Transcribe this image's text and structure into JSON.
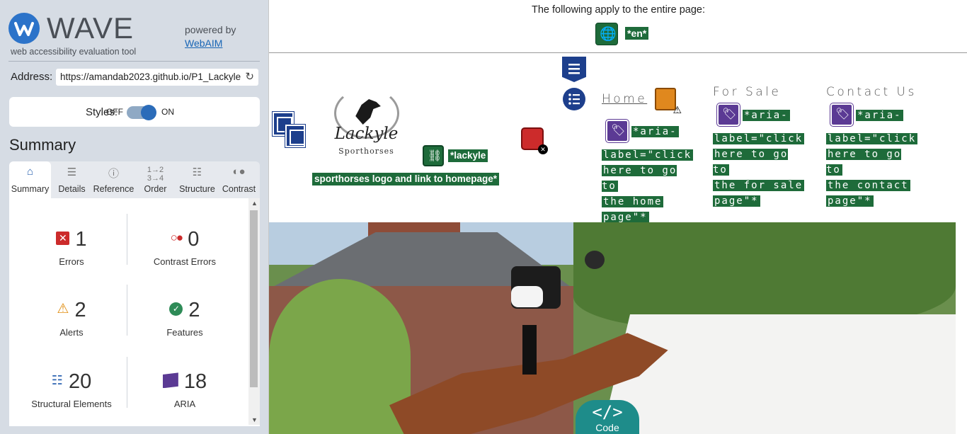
{
  "wave": {
    "logo_text": "WAVE",
    "logo_sub": "web accessibility evaluation tool",
    "powered_by": "powered by",
    "webaim_link": "WebAIM",
    "address_label": "Address:",
    "address_value": "https://amandab2023.github.io/P1_Lackyle",
    "styles_label": "Styles:",
    "styles_off": "OFF",
    "styles_on": "ON",
    "summary_title": "Summary",
    "tabs": [
      {
        "label": "Summary",
        "icon": "home-icon"
      },
      {
        "label": "Details",
        "icon": "list-icon"
      },
      {
        "label": "Reference",
        "icon": "info-icon"
      },
      {
        "label": "Order",
        "icon": "order-icon"
      },
      {
        "label": "Structure",
        "icon": "structure-icon"
      },
      {
        "label": "Contrast",
        "icon": "contrast-icon"
      }
    ],
    "stats": {
      "errors": {
        "value": "1",
        "label": "Errors"
      },
      "contrast_errors": {
        "value": "0",
        "label": "Contrast Errors"
      },
      "alerts": {
        "value": "2",
        "label": "Alerts"
      },
      "features": {
        "value": "2",
        "label": "Features"
      },
      "structural": {
        "value": "20",
        "label": "Structural Elements"
      },
      "aria": {
        "value": "18",
        "label": "ARIA"
      }
    },
    "colors": {
      "accent": "#2c63b1",
      "error": "#cc2b2b",
      "alert": "#e08d10",
      "feature": "#2e8b57",
      "aria": "#5b3a94"
    }
  },
  "page": {
    "top_notice": "The following apply to the entire page:",
    "lang_tag": "*en*",
    "logo_script": "Lackyle",
    "logo_sub": "Sporthorses",
    "logo_alt_1": "*lackyle",
    "logo_alt_2": "sporthorses logo and link to homepage*",
    "nav": [
      {
        "label": "Home",
        "aria": [
          "*aria-",
          "label=\"click",
          "here to go to",
          "the home",
          "page\"*"
        ]
      },
      {
        "label": "For Sale",
        "aria": [
          "*aria-",
          "label=\"click",
          "here to go to",
          "the for sale",
          "page\"*"
        ]
      },
      {
        "label": "Contact Us",
        "aria": [
          "*aria-",
          "label=\"click",
          "here to go to",
          "the contact",
          "page\"*"
        ]
      }
    ],
    "code_button": "Code",
    "code_symbol": "</>"
  }
}
